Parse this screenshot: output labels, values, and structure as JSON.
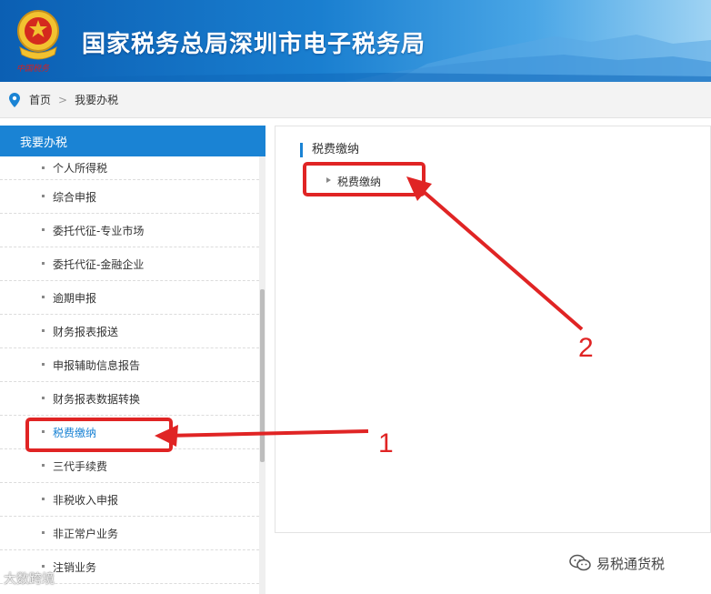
{
  "header": {
    "title": "国家税务总局深圳市电子税务局",
    "emblem_script": "中国税务"
  },
  "breadcrumb": {
    "home": "首页",
    "separator": ">",
    "current": "我要办税"
  },
  "sidebar": {
    "heading": "我要办税",
    "items": [
      {
        "label": "个人所得税",
        "active": false
      },
      {
        "label": "综合申报",
        "active": false
      },
      {
        "label": "委托代征-专业市场",
        "active": false
      },
      {
        "label": "委托代征-金融企业",
        "active": false
      },
      {
        "label": "逾期申报",
        "active": false
      },
      {
        "label": "财务报表报送",
        "active": false
      },
      {
        "label": "申报辅助信息报告",
        "active": false
      },
      {
        "label": "财务报表数据转换",
        "active": false
      },
      {
        "label": "税费缴纳",
        "active": true
      },
      {
        "label": "三代手续费",
        "active": false
      },
      {
        "label": "非税收入申报",
        "active": false
      },
      {
        "label": "非正常户业务",
        "active": false
      },
      {
        "label": "注销业务",
        "active": false
      }
    ]
  },
  "main": {
    "section_title": "税费缴纳",
    "sub_link": "税费缴纳"
  },
  "annotations": {
    "label_1": "1",
    "label_2": "2",
    "color": "#e02424"
  },
  "watermarks": {
    "left": "大数跨境",
    "right": "易税通货税"
  },
  "colors": {
    "brand_blue": "#1a83d4",
    "annotation_red": "#e02424"
  }
}
